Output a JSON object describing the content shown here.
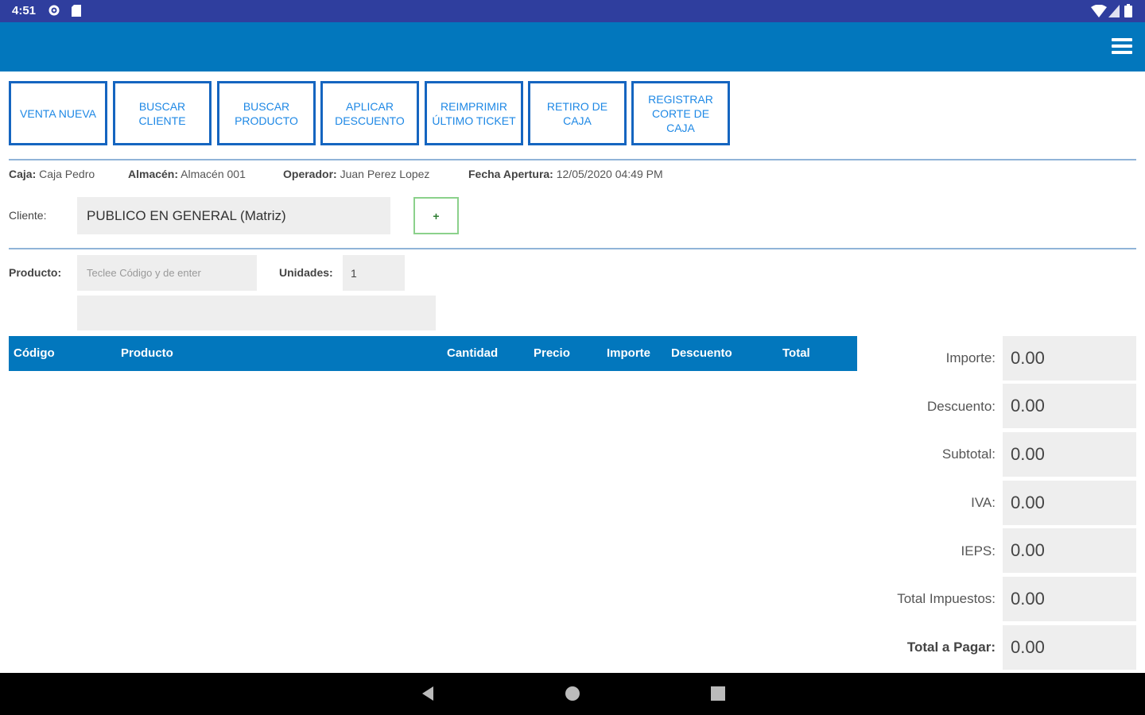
{
  "status_bar": {
    "time": "4:51",
    "icons": [
      "gear-icon",
      "sdcard-icon",
      "wifi-icon",
      "signal-icon",
      "battery-icon"
    ]
  },
  "app_bar": {
    "menu_icon": "hamburger-icon"
  },
  "actions": [
    {
      "label": "VENTA NUEVA"
    },
    {
      "label": "BUSCAR CLIENTE"
    },
    {
      "label": "BUSCAR PRODUCTO"
    },
    {
      "label": "APLICAR DESCUENTO"
    },
    {
      "label": "REIMPRIMIR ÚLTIMO TICKET"
    },
    {
      "label": "RETIRO DE CAJA"
    },
    {
      "label": "REGISTRAR CORTE DE CAJA"
    }
  ],
  "session": {
    "caja_label": "Caja:",
    "caja_value": "Caja Pedro",
    "almacen_label": "Almacén:",
    "almacen_value": "Almacén 001",
    "operador_label": "Operador:",
    "operador_value": "Juan Perez Lopez",
    "fecha_label": "Fecha Apertura:",
    "fecha_value": "12/05/2020 04:49 PM"
  },
  "cliente": {
    "label": "Cliente:",
    "value": "PUBLICO EN GENERAL (Matriz)",
    "add_label": "+"
  },
  "producto": {
    "label": "Producto:",
    "placeholder": "Teclee Código y de enter",
    "units_label": "Unidades:",
    "units_value": "1"
  },
  "table": {
    "headers": [
      "Código",
      "Producto",
      "Cantidad",
      "Precio",
      "Importe",
      "Descuento",
      "Total"
    ]
  },
  "totals": [
    {
      "label": "Importe:",
      "value": "0.00"
    },
    {
      "label": "Descuento:",
      "value": "0.00"
    },
    {
      "label": "Subtotal:",
      "value": "0.00"
    },
    {
      "label": "IVA:",
      "value": "0.00"
    },
    {
      "label": "IEPS:",
      "value": "0.00"
    },
    {
      "label": "Total Impuestos:",
      "value": "0.00"
    },
    {
      "label": "Total a Pagar:",
      "value": "0.00"
    }
  ],
  "nav_bar": {
    "icons": [
      "back-icon",
      "home-icon",
      "recents-icon"
    ]
  },
  "colors": {
    "status_bar": "#2f3e9e",
    "app_bar": "#0277bd",
    "button_border": "#1565c0",
    "button_text": "#1e88e5",
    "field_bg": "#eeeeee"
  }
}
